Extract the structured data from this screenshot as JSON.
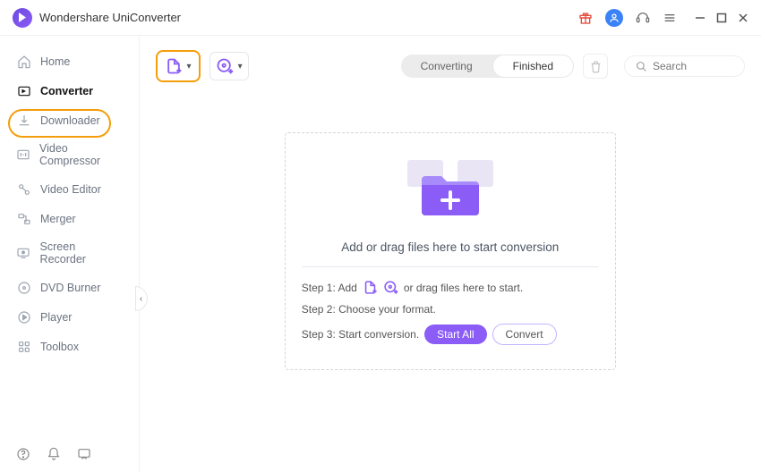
{
  "app": {
    "title": "Wondershare UniConverter"
  },
  "sidebar": {
    "items": [
      {
        "label": "Home",
        "icon": "home-icon"
      },
      {
        "label": "Converter",
        "icon": "converter-icon"
      },
      {
        "label": "Downloader",
        "icon": "downloader-icon"
      },
      {
        "label": "Video Compressor",
        "icon": "compressor-icon"
      },
      {
        "label": "Video Editor",
        "icon": "editor-icon"
      },
      {
        "label": "Merger",
        "icon": "merger-icon"
      },
      {
        "label": "Screen Recorder",
        "icon": "recorder-icon"
      },
      {
        "label": "DVD Burner",
        "icon": "dvd-icon"
      },
      {
        "label": "Player",
        "icon": "player-icon"
      },
      {
        "label": "Toolbox",
        "icon": "toolbox-icon"
      }
    ]
  },
  "tabs": {
    "converting": "Converting",
    "finished": "Finished"
  },
  "search": {
    "placeholder": "Search"
  },
  "dropzone": {
    "main_text": "Add or drag files here to start conversion",
    "step1_prefix": "Step 1: Add",
    "step1_suffix": "or drag files here to start.",
    "step2": "Step 2: Choose your format.",
    "step3": "Step 3: Start conversion.",
    "start_all": "Start All",
    "convert": "Convert"
  },
  "colors": {
    "accent": "#8b5cf6",
    "highlight": "#f59e0b"
  }
}
